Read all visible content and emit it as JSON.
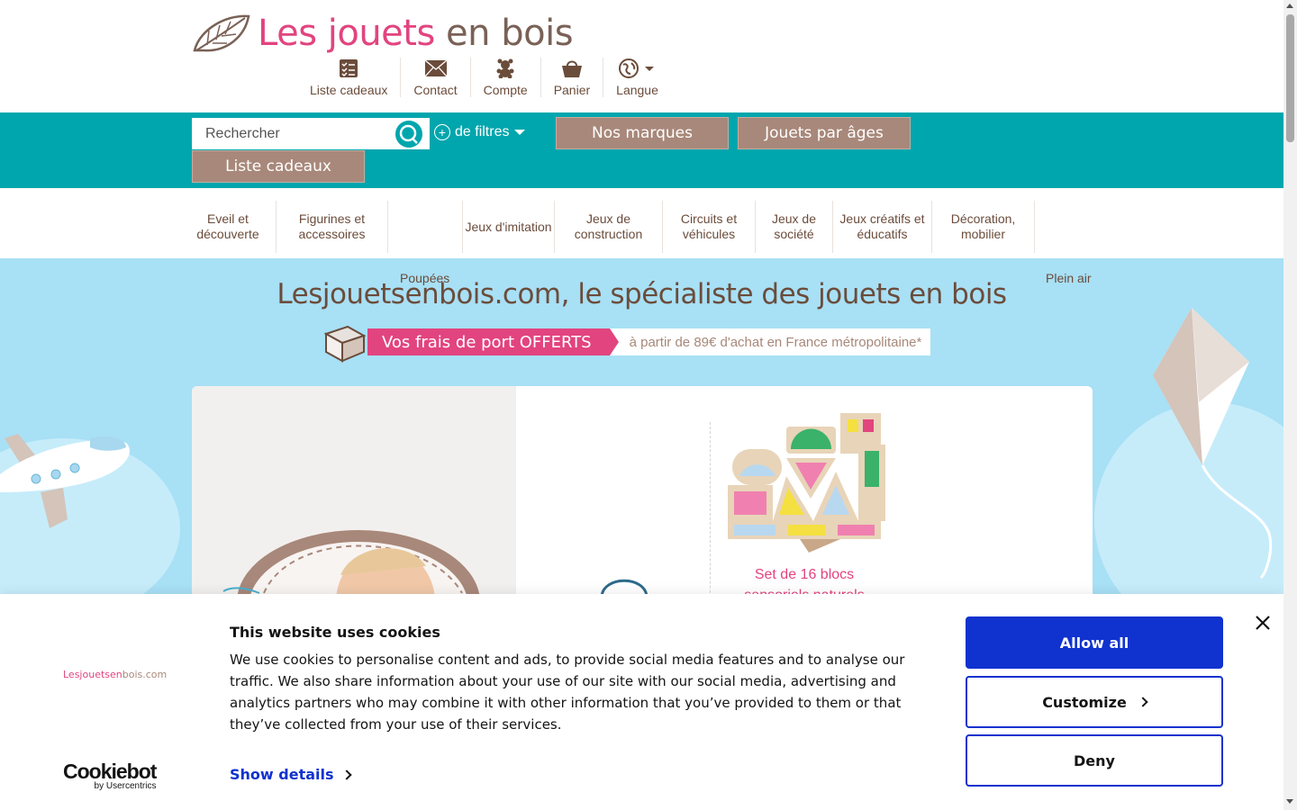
{
  "logo": {
    "part1": "Les jouets",
    "part2": " en bois"
  },
  "top_nav": [
    {
      "label": "Liste cadeaux",
      "icon": "checklist-icon"
    },
    {
      "label": "Contact",
      "icon": "envelope-icon"
    },
    {
      "label": "Compte",
      "icon": "teddy-bear-icon"
    },
    {
      "label": "Panier",
      "icon": "basket-icon"
    },
    {
      "label": "Langue",
      "icon": "globe-icon"
    }
  ],
  "search": {
    "placeholder": "Rechercher",
    "filters_label": "de filtres"
  },
  "band_buttons": {
    "brands": "Nos marques",
    "ages": "Jouets par âges",
    "gift_list": "Liste cadeaux"
  },
  "categories": [
    "Eveil et découverte",
    "Figurines et accessoires",
    "",
    "Jeux d'imitation",
    "Jeux de construction",
    "Circuits et véhicules",
    "Jeux de société",
    "Jeux créatifs et éducatifs",
    "Décoration, mobilier"
  ],
  "categories_row2": {
    "left": "Poupées",
    "right": "Plein air"
  },
  "hero": {
    "title": "Lesjouetsenbois.com, le spécialiste des jouets en bois",
    "shipping_main": "Vos frais de port OFFERTS",
    "shipping_sub": "à partir de 89€ d'achat en France métropolitaine*",
    "product_name": "Set de 16 blocs sensoriels naturels"
  },
  "cookie": {
    "site_logo_a": "Lesjouetsen",
    "site_logo_b": "bois.com",
    "title": "This website uses cookies",
    "body": "We use cookies to personalise content and ads, to provide social media features and to analyse our traffic. We also share information about your use of our site with our social media, advertising and analytics partners who may combine it with other information that you’ve provided to them or that they’ve collected from your use of their services.",
    "show_details": "Show details",
    "allow_all": "Allow all",
    "customize": "Customize",
    "deny": "Deny",
    "brand": "Cookiebot",
    "brand_sub": "by Usercentrics"
  },
  "colors": {
    "teal": "#00a6ad",
    "pink": "#e2447f",
    "brown": "#6b4c3b",
    "button_brown": "#a8887a",
    "sky": "#a8e0f5",
    "cookie_blue": "#1032cf"
  }
}
